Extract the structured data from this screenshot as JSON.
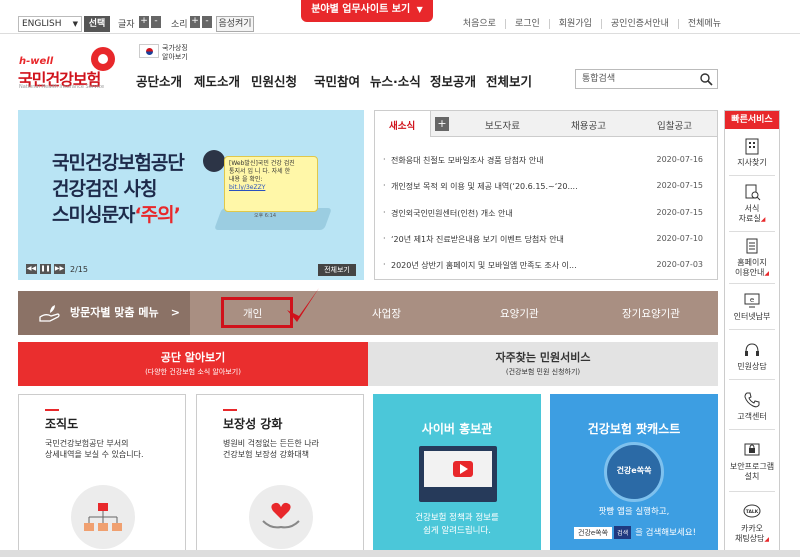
{
  "util": {
    "language": "ENGLISH",
    "select_label": "선택",
    "text_size_label": "글자",
    "plus": "+",
    "minus": "-",
    "sound_label": "소리",
    "sound_button": "음성켜기",
    "site_tab": "분야별 업무사이트 보기",
    "top_links": [
      "처음으로",
      "로그인",
      "회원가입",
      "공인인증서안내",
      "전체메뉴"
    ]
  },
  "header": {
    "logo_hwell": "h-well",
    "logo_name": "국민건강보험",
    "logo_sub": "National Health Insurance Service",
    "national_symbol_line1": "국가상징",
    "national_symbol_line2": "알아보기",
    "gnb": [
      "공단소개",
      "제도소개",
      "민원신청",
      "국민참여",
      "뉴스·소식",
      "정보공개",
      "전체보기"
    ],
    "search_placeholder": "통합검색"
  },
  "banner": {
    "title_line1": "국민건강보험공단",
    "title_line2": "건강검진 사칭",
    "title_line3_a": "스미싱문자",
    "title_line3_b": "‘주의’",
    "msg_line1": "[Web발신]국민 건강 검진",
    "msg_line2": "통지서 입 니 다. 자세 한",
    "msg_line3": "내용 을 확인:",
    "msg_link": "bit.ly/3eZZY",
    "msg_time": "오후 6:14",
    "pager": "2/15",
    "view_all": "전체보기"
  },
  "news": {
    "tabs": [
      "새소식",
      "보도자료",
      "채용공고",
      "입찰공고"
    ],
    "more": "+",
    "items": [
      {
        "title": "전화응대 친절도 모바일조사 경품 당첨자 안내",
        "date": "2020-07-16"
      },
      {
        "title": "개인정보 목적 외 이용 및 제공 내역(‘20.6.15.~‘20....",
        "date": "2020-07-15"
      },
      {
        "title": "경인외국인민원센터(인천) 개소 안내",
        "date": "2020-07-15"
      },
      {
        "title": "‘20년 제1차 진료받은내용 보기 이벤트 당첨자 안내",
        "date": "2020-07-10"
      },
      {
        "title": "2020년 상반기 홈페이지 및 모바일앱 만족도 조사 이...",
        "date": "2020-07-03"
      }
    ]
  },
  "visitor": {
    "label": "방문자별 맞춤 메뉴",
    "arrow": ">",
    "items": [
      "개인",
      "사업장",
      "요양기관",
      "장기요양기관"
    ]
  },
  "bigtabs": [
    {
      "title": "공단 알아보기",
      "sub": "(다양한 건강보험 소식 알아보기)"
    },
    {
      "title": "자주찾는 민원서비스",
      "sub": "(건강보험 민원 신청하기)"
    }
  ],
  "cards": {
    "org": {
      "title": "조직도",
      "desc_line1": "국민건강보험공단 부서의",
      "desc_line2": "상세내역을 보실 수 있습니다."
    },
    "coverage": {
      "title": "보장성 강화",
      "desc_line1": "병원비 걱정없는 든든한 나라",
      "desc_line2": "건강보험 보장성 강화대책"
    },
    "cyber": {
      "title": "사이버 홍보관",
      "desc_line1": "건강보험 정책과 정보를",
      "desc_line2": "쉽게 알려드립니다."
    },
    "podcast": {
      "title": "건강보험 팟캐스트",
      "circle_label": "건강e쏙쏙",
      "desc_line1": "팟빵 앱을 실행하고,",
      "search_text": "건강e쏙쏙",
      "search_btn": "검색",
      "desc_line2": "을 검색해보세요!"
    }
  },
  "quick": {
    "title": "빠른서비스",
    "items": [
      {
        "line1": "지사찾기",
        "line2": ""
      },
      {
        "line1": "서식",
        "line2": "자료실"
      },
      {
        "line1": "홈페이지",
        "line2": "이용안내"
      },
      {
        "line1": "인터넷납부",
        "line2": ""
      },
      {
        "line1": "민원상담",
        "line2": ""
      },
      {
        "line1": "고객센터",
        "line2": ""
      },
      {
        "line1": "보안프로그램",
        "line2": "설치"
      },
      {
        "line1": "카카오",
        "line2": "채팅상담"
      }
    ],
    "talk": "TALK"
  },
  "colors": {
    "brand_red": "#e8282b",
    "visitor_bar": "#a98f82",
    "cyan_card": "#4bc7d9",
    "blue_card": "#3d9ee2"
  }
}
